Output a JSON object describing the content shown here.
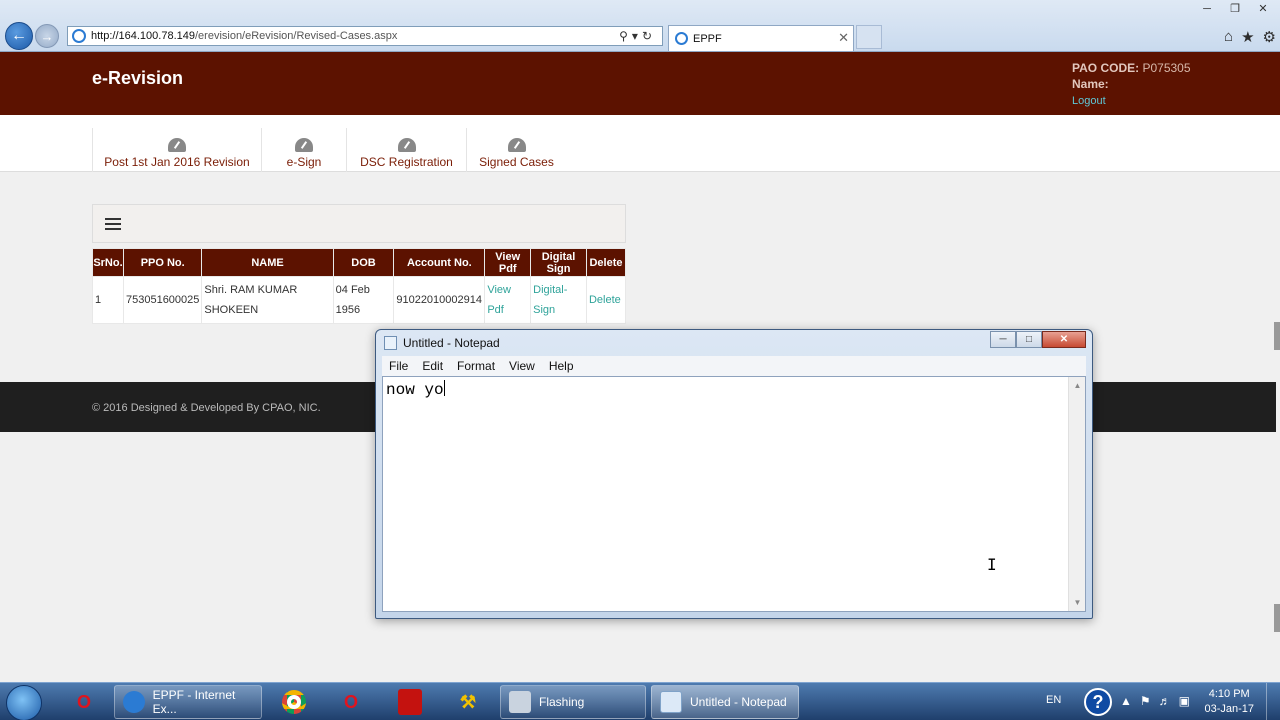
{
  "browser": {
    "url_host": "http://164.100.78.149",
    "url_path": "/erevision/eRevision/Revised-Cases.aspx",
    "tab_title": "EPPF"
  },
  "site": {
    "brand": "e-Revision",
    "pao_code_label": "PAO CODE:",
    "pao_code_value": "P075305",
    "name_label": "Name:",
    "logout": "Logout"
  },
  "menu": [
    {
      "label": "Post 1st Jan 2016 Revision"
    },
    {
      "label": "e-Sign"
    },
    {
      "label": "DSC Registration"
    },
    {
      "label": "Signed Cases"
    }
  ],
  "table": {
    "headers": [
      "SrNo.",
      "PPO No.",
      "NAME",
      "DOB",
      "Account No.",
      "View Pdf",
      "Digital Sign",
      "Delete"
    ],
    "rows": [
      {
        "srno": "1",
        "ppo": "753051600025",
        "name_line1": "Shri. RAM KUMAR",
        "name_line2": "SHOKEEN",
        "dob_line1": "04 Feb",
        "dob_line2": "1956",
        "account": "91022010002914",
        "view_pdf_line1": "View",
        "view_pdf_line2": "Pdf",
        "digital_line1": "Digital-",
        "digital_line2": "Sign",
        "delete": "Delete"
      }
    ]
  },
  "footer": {
    "text": "© 2016 Designed & Developed By CPAO, NIC."
  },
  "notepad": {
    "title": "Untitled - Notepad",
    "menu": [
      "File",
      "Edit",
      "Format",
      "View",
      "Help"
    ],
    "content": "now yo"
  },
  "taskbar": {
    "items": [
      {
        "label": "EPPF - Internet Ex..."
      },
      {
        "label": "Flashing"
      },
      {
        "label": "Untitled - Notepad"
      }
    ],
    "lang": "EN",
    "time": "4:10 PM",
    "date": "03-Jan-17"
  },
  "colors": {
    "header_bg": "#5c1200",
    "link": "#2fa39a",
    "menu_text": "#7a1d06"
  }
}
